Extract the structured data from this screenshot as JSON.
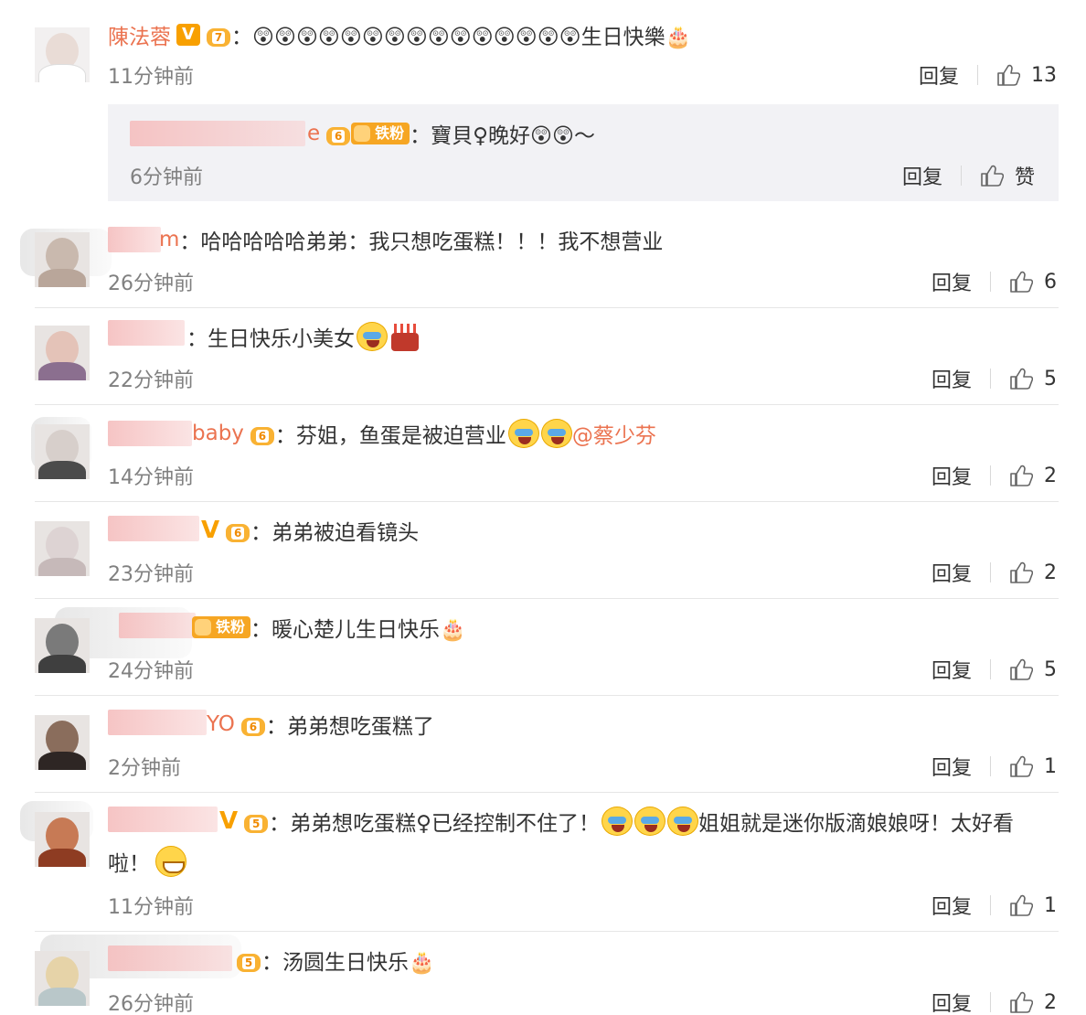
{
  "accent_color": "#eb7350",
  "badges": {
    "v": "V",
    "iron_fan": "铁粉",
    "crown_levels": [
      "7",
      "6",
      "6",
      "6",
      "6",
      "5"
    ]
  },
  "icons": {
    "like": "thumb-up-icon",
    "emoji": "surprised-face-icon",
    "cry": "laugh-cry-icon",
    "cake": "birthday-cake-icon",
    "grin": "grin-icon"
  },
  "comments": [
    {
      "name": "陳法蓉",
      "text": "：😲😲😲😲😲😲😲😲😲😲😲😲😲😲😲生日快樂🎂",
      "time": "11分钟前",
      "reply": "回复",
      "likes": "13"
    },
    {
      "name_tail": "e",
      "text": "：寶貝♀晚好😲😲～",
      "time": "6分钟前",
      "reply": "回复",
      "likes": "赞"
    },
    {
      "name_tail": "m",
      "text": "：哈哈哈哈哈弟弟：我只想吃蛋糕！！！我不想营业",
      "time": "26分钟前",
      "reply": "回复",
      "likes": "6"
    },
    {
      "name_tail": "",
      "text": "：生日快乐小美女",
      "time": "22分钟前",
      "reply": "回复",
      "likes": "5"
    },
    {
      "name_tail": "baby",
      "text": "：芬姐，鱼蛋是被迫营业",
      "mention": "@蔡少芬",
      "time": "14分钟前",
      "reply": "回复",
      "likes": "2"
    },
    {
      "name_tail": "V",
      "text": "：弟弟被迫看镜头",
      "time": "23分钟前",
      "reply": "回复",
      "likes": "2"
    },
    {
      "name_tail": "",
      "text": "：暖心楚儿生日快乐🎂",
      "time": "24分钟前",
      "reply": "回复",
      "likes": "5"
    },
    {
      "name_tail": "YO",
      "text": "：弟弟想吃蛋糕了",
      "time": "2分钟前",
      "reply": "回复",
      "likes": "1"
    },
    {
      "name_tail": "V",
      "text": "：弟弟想吃蛋糕♀已经控制不住了！",
      "text2": "姐姐就是迷你版滴娘娘呀！太好看",
      "text3": "啦！",
      "time": "11分钟前",
      "reply": "回复",
      "likes": "1"
    },
    {
      "name_tail": "",
      "text": "：汤圆生日快乐🎂",
      "time": "26分钟前",
      "reply": "回复",
      "likes": "2"
    }
  ]
}
